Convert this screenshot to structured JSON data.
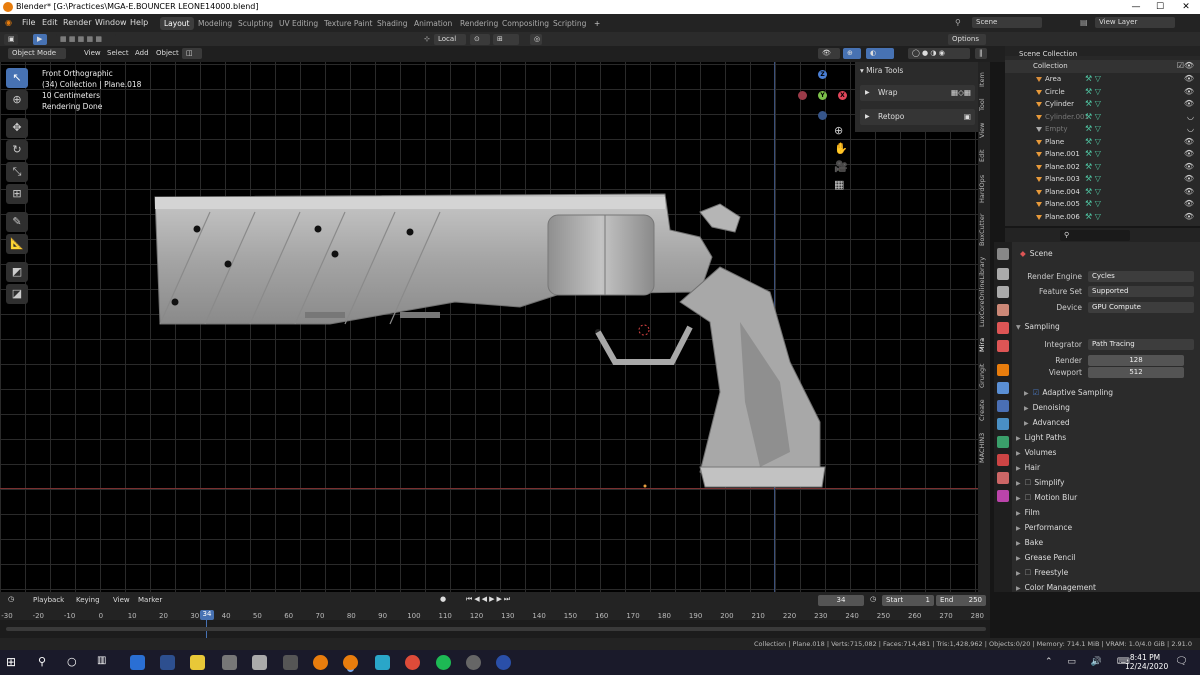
{
  "window": {
    "title": "Blender* [G:\\Practices\\MGA-E.BOUNCER LEONE14000.blend]"
  },
  "menu": [
    "File",
    "Edit",
    "Render",
    "Window",
    "Help"
  ],
  "workspaces": [
    "Layout",
    "Modeling",
    "Sculpting",
    "UV Editing",
    "Texture Paint",
    "Shading",
    "Animation",
    "Rendering",
    "Compositing",
    "Scripting"
  ],
  "active_workspace": "Layout",
  "scene": {
    "label": "Scene",
    "view_layer": "View Layer"
  },
  "header": {
    "transform": "Local",
    "options": "Options"
  },
  "viewport_header": {
    "mode": "Object Mode",
    "view": "View",
    "select": "Select",
    "add": "Add",
    "object": "Object"
  },
  "overlay_info": [
    "Front Orthographic",
    "(34) Collection | Plane.018",
    "10 Centimeters",
    "Rendering Done"
  ],
  "mira": {
    "title": "Mira Tools",
    "rows": [
      "Wrap",
      "Retopo"
    ]
  },
  "n_tabs": [
    "Item",
    "Tool",
    "View",
    "Edit",
    "HardOps",
    "BoxCutter",
    "LuxCoreOnlineLibrary",
    "Mira",
    "Grungit",
    "Create",
    "MACHIN3"
  ],
  "outliner": {
    "root": "Scene Collection",
    "collection": "Collection",
    "items": [
      {
        "name": "Area",
        "color": "#d98d3a",
        "dim": false
      },
      {
        "name": "Circle",
        "color": "#e89a3a",
        "dim": false
      },
      {
        "name": "Cylinder",
        "color": "#e89a3a",
        "dim": false
      },
      {
        "name": "Cylinder.001",
        "color": "#e89a3a",
        "dim": true
      },
      {
        "name": "Empty",
        "color": "#aaaaaa",
        "dim": true
      },
      {
        "name": "Plane",
        "color": "#e89a3a",
        "dim": false
      },
      {
        "name": "Plane.001",
        "color": "#e89a3a",
        "dim": false
      },
      {
        "name": "Plane.002",
        "color": "#e89a3a",
        "dim": false
      },
      {
        "name": "Plane.003",
        "color": "#e89a3a",
        "dim": false
      },
      {
        "name": "Plane.004",
        "color": "#e89a3a",
        "dim": false
      },
      {
        "name": "Plane.005",
        "color": "#e89a3a",
        "dim": false
      },
      {
        "name": "Plane.006",
        "color": "#e89a3a",
        "dim": false
      }
    ]
  },
  "properties": {
    "context": "Scene",
    "render_engine_label": "Render Engine",
    "render_engine": "Cycles",
    "feature_set_label": "Feature Set",
    "feature_set": "Supported",
    "device_label": "Device",
    "device": "GPU Compute",
    "sampling": "Sampling",
    "integrator_label": "Integrator",
    "integrator": "Path Tracing",
    "render_label": "Render",
    "render_samples": "128",
    "viewport_label": "Viewport",
    "viewport_samples": "512",
    "adaptive": "Adaptive Sampling",
    "denoising": "Denoising",
    "advanced": "Advanced",
    "sections": [
      "Light Paths",
      "Volumes",
      "Hair",
      "Simplify",
      "Motion Blur",
      "Film",
      "Performance",
      "Bake",
      "Grease Pencil",
      "Freestyle",
      "Color Management"
    ]
  },
  "timeline": {
    "menu": [
      "Playback",
      "Keying",
      "View",
      "Marker"
    ],
    "current_frame": "34",
    "start_label": "Start",
    "start": "1",
    "end_label": "End",
    "end": "250",
    "ticks": [
      "-30",
      "-20",
      "-10",
      "0",
      "10",
      "20",
      "30",
      "40",
      "50",
      "60",
      "70",
      "80",
      "90",
      "100",
      "110",
      "120",
      "130",
      "140",
      "150",
      "160",
      "170",
      "180",
      "190",
      "200",
      "210",
      "220",
      "230",
      "240",
      "250",
      "260",
      "270",
      "280"
    ]
  },
  "status": "Collection | Plane.018 | Verts:715,082 | Faces:714,481 | Tris:1,428,962 | Objects:0/20 | Memory: 714.1 MiB | VRAM: 1.0/4.0 GiB | 2.91.0",
  "clock": {
    "time": "8:41 PM",
    "date": "12/24/2020"
  }
}
